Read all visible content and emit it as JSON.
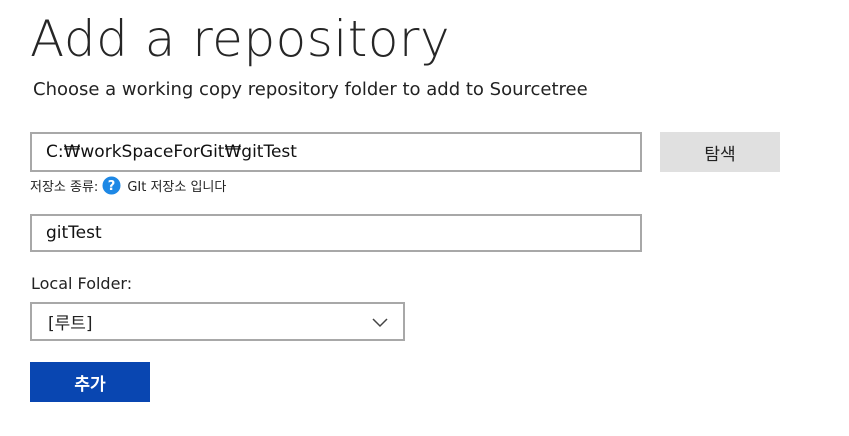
{
  "header": {
    "title": "Add a repository",
    "subtitle": "Choose a working copy repository folder to add to Sourcetree"
  },
  "path_field": {
    "value": "C:₩workSpaceForGit₩gitTest"
  },
  "browse_button": {
    "label": "탐색"
  },
  "repo_type": {
    "label": "저장소 종류:",
    "value": "GIt 저장소 입니다",
    "icon": "help-icon",
    "icon_color": "#1e88e5"
  },
  "name_field": {
    "value": "gitTest"
  },
  "local_folder": {
    "label": "Local Folder:",
    "selected": "[루트]"
  },
  "add_button": {
    "label": "추가",
    "color": "#0946b1"
  }
}
